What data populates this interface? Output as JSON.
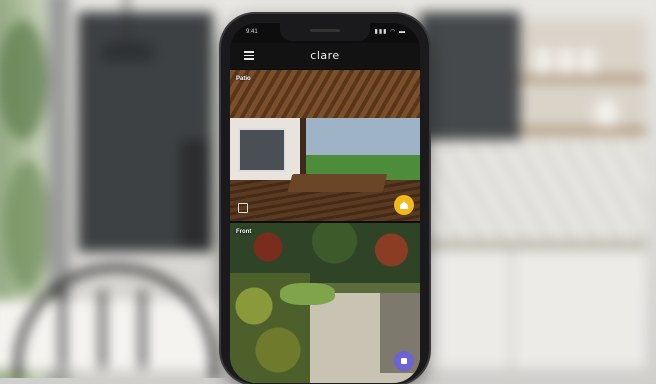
{
  "phone": {
    "status_time": "9:41",
    "status_icons": "▮▮▮ ◠ ▬",
    "app_logo": "clare",
    "cameras": [
      {
        "label": "Patio",
        "badge_color": "#f2b81c",
        "badge_icon": "home-icon"
      },
      {
        "label": "Front",
        "badge_color": "#6b63d6",
        "badge_icon": "away-icon"
      }
    ]
  },
  "colors": {
    "accent_yellow": "#f2b81c",
    "accent_purple": "#6b63d6"
  }
}
